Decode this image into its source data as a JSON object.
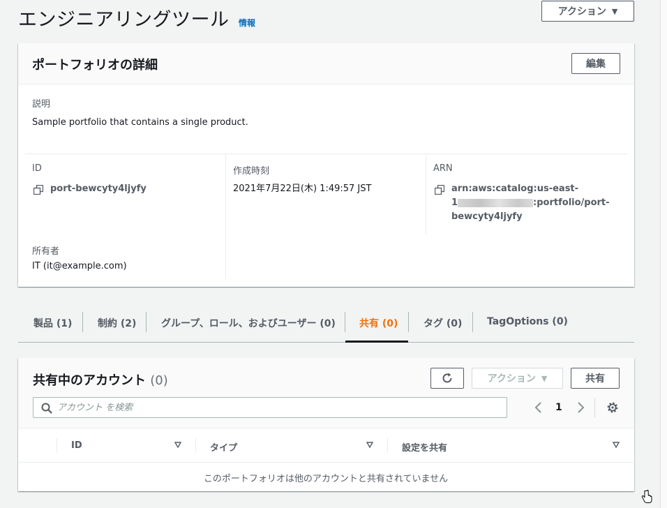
{
  "page": {
    "title": "エンジニアリングツール",
    "info_link": "情報",
    "actions_label": "アクション"
  },
  "details": {
    "title": "ポートフォリオの詳細",
    "edit_label": "編集",
    "description_label": "説明",
    "description_value": "Sample portfolio that contains a single product.",
    "id_label": "ID",
    "id_value": "port-bewcyty4ljyfy",
    "created_label": "作成時刻",
    "created_value": "2021年7月22日(木) 1:49:57 JST",
    "arn_label": "ARN",
    "arn_line1": "arn:aws:catalog:us-east-",
    "arn_line2_prefix": "1",
    "arn_line2_suffix": ":portfolio/port-",
    "arn_line3": "bewcyty4ljyfy",
    "owner_label": "所有者",
    "owner_value": "IT (it@example.com)"
  },
  "tabs": [
    {
      "label": "製品 (1)",
      "active": false
    },
    {
      "label": "制約 (2)",
      "active": false
    },
    {
      "label": "グループ、ロール、およびユーザー (0)",
      "active": false
    },
    {
      "label": "共有 (0)",
      "active": true
    },
    {
      "label": "タグ (0)",
      "active": false
    },
    {
      "label": "TagOptions (0)",
      "active": false
    }
  ],
  "shares": {
    "title": "共有中のアカウント",
    "count": "(0)",
    "actions_label": "アクション",
    "share_label": "共有",
    "search_placeholder": "アカウント を検索",
    "page_number": "1",
    "columns": [
      "ID",
      "タイプ",
      "設定を共有"
    ],
    "empty_message": "このポートフォリオは他のアカウントと共有されていません"
  },
  "colors": {
    "accent": "#ec7211",
    "link": "#0073bb",
    "text": "#16191f",
    "muted": "#545b64"
  }
}
